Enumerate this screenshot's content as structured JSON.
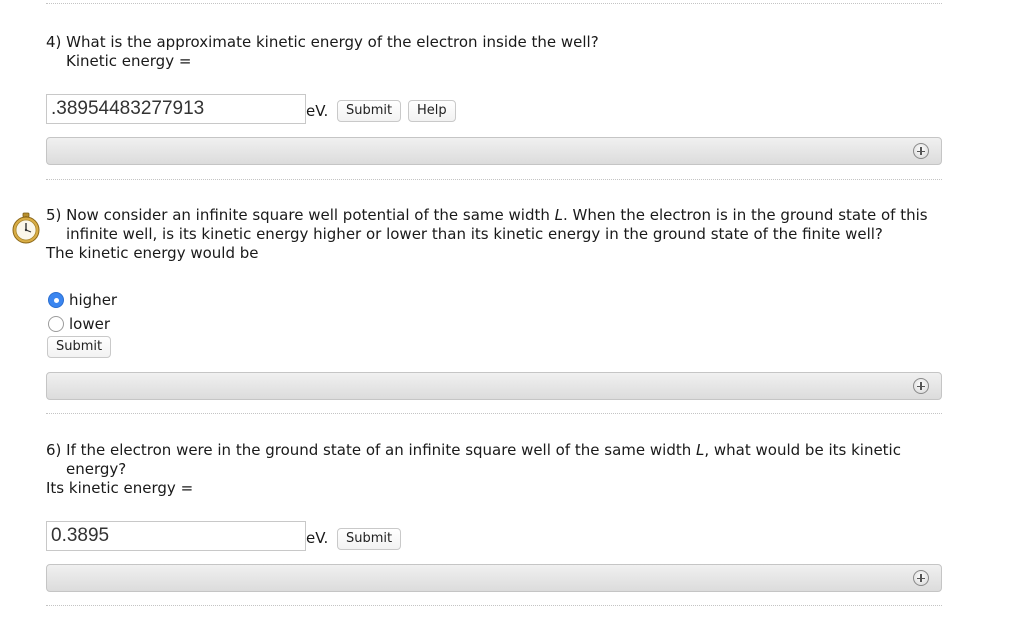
{
  "q4": {
    "question": "4) What is the approximate kinetic energy of the electron inside the well?",
    "prompt": "Kinetic energy =",
    "input_value": ".38954483277913",
    "unit": "eV.",
    "submit_label": "Submit",
    "help_label": "Help"
  },
  "q5": {
    "line1_pre": "5) Now consider an infinite square well potential of the same width ",
    "line1_var": "L",
    "line1_post": ". When the electron is in the ground state of this",
    "line2": "infinite well, is its kinetic energy higher or lower than its kinetic energy in the ground state of the finite well?",
    "prompt": "The kinetic energy would be",
    "options": [
      {
        "label": "higher",
        "selected": true
      },
      {
        "label": "lower",
        "selected": false
      }
    ],
    "submit_label": "Submit"
  },
  "q6": {
    "line1_pre": "6) If the electron were in the ground state of an infinite square well of the same width ",
    "line1_var": "L",
    "line1_post": ", what would be its kinetic",
    "line2": "energy?",
    "prompt": "Its kinetic energy =",
    "input_value": "0.3895",
    "unit": "eV.",
    "submit_label": "Submit"
  },
  "icons": {
    "expand": "plus-circle-icon",
    "timer": "stopwatch-icon"
  },
  "colors": {
    "radio_selected": "#3b86f0",
    "panel_bg": "#e4e4e4"
  }
}
